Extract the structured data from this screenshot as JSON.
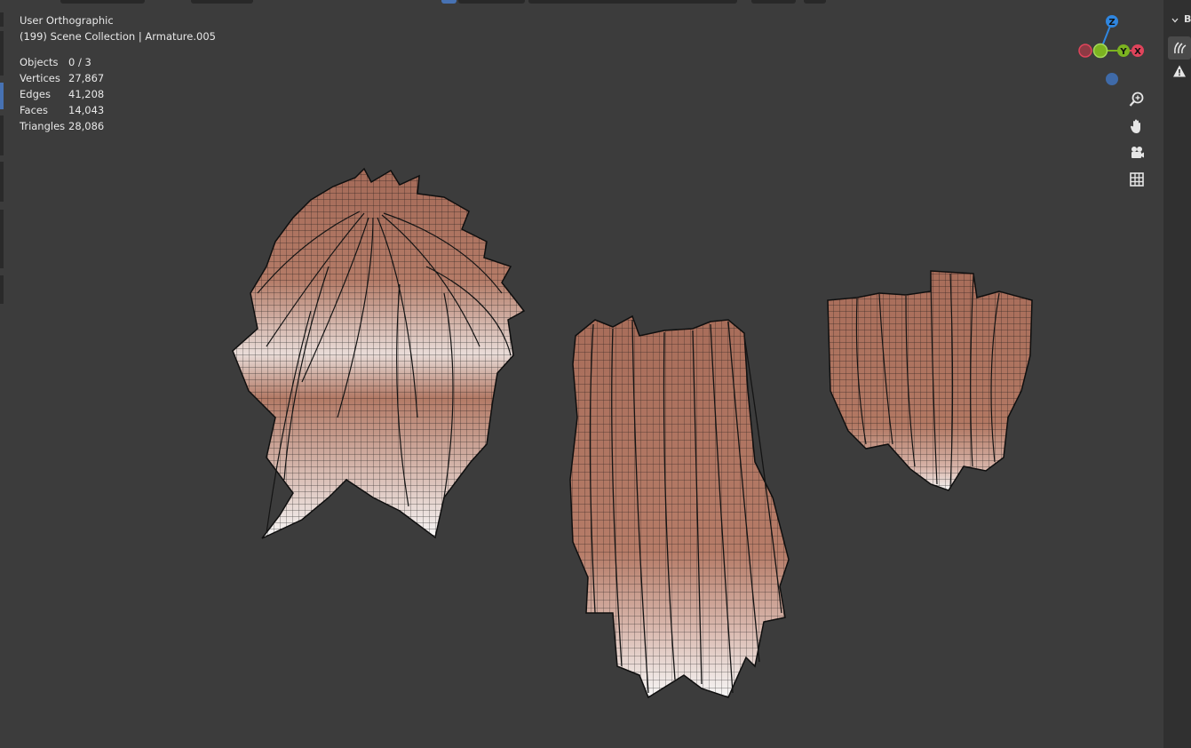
{
  "viewport": {
    "view_name": "User Orthographic",
    "collection_line": "(199) Scene Collection | Armature.005"
  },
  "stats": [
    {
      "label": "Objects",
      "value": "0 / 3"
    },
    {
      "label": "Vertices",
      "value": "27,867"
    },
    {
      "label": "Edges",
      "value": "41,208"
    },
    {
      "label": "Faces",
      "value": "14,043"
    },
    {
      "label": "Triangles",
      "value": "28,086"
    }
  ],
  "gizmo": {
    "z_label": "Z",
    "x_label": "X",
    "y_label": "Y",
    "colors": {
      "x": "#e0445b",
      "y": "#7cb320",
      "z": "#2f86e0",
      "neg_z": "#3f6aa8",
      "neg_x": "#8d3a44",
      "neg_y": "#4e7a1d"
    }
  },
  "nav_buttons": [
    {
      "icon": "zoom-icon"
    },
    {
      "icon": "hand-pan-icon"
    },
    {
      "icon": "camera-icon"
    },
    {
      "icon": "grid-icon"
    }
  ],
  "sidebar": {
    "header_label": "B",
    "tabs": [
      {
        "icon": "hair-curves-icon"
      },
      {
        "icon": "warning-icon"
      }
    ]
  },
  "colors": {
    "background": "#3c3c3c",
    "hair_base": "#b07562",
    "hair_tip": "#f2f2f2",
    "wire": "#111111",
    "accent": "#4772b3"
  }
}
